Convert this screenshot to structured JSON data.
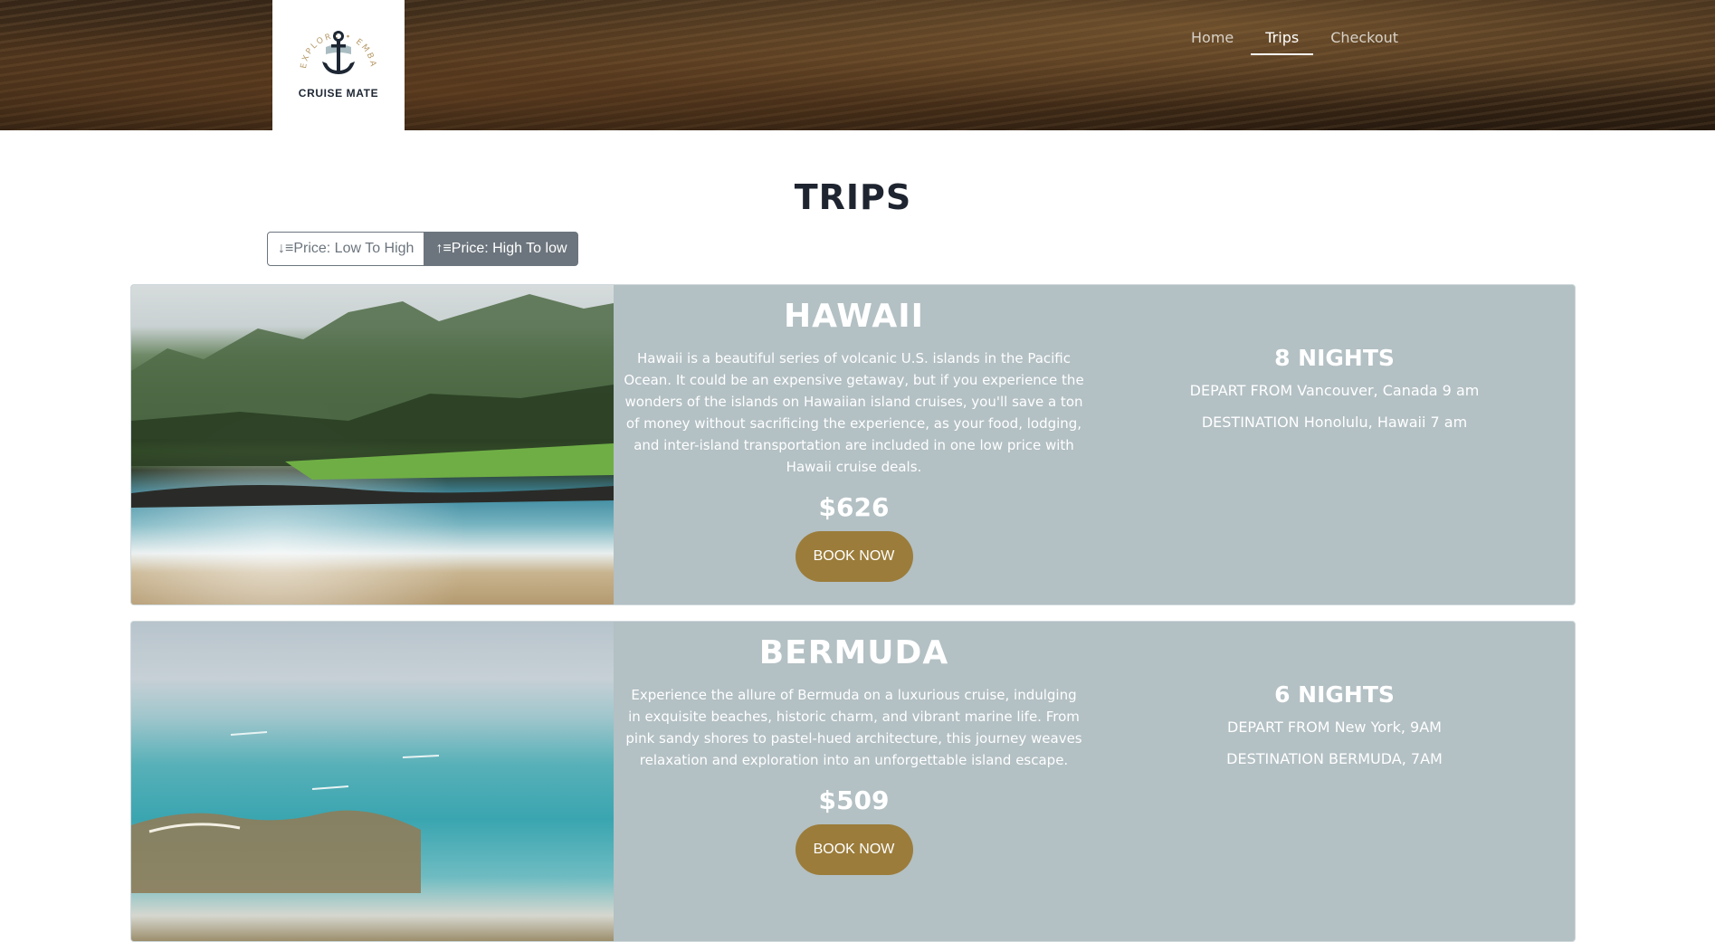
{
  "brand": {
    "name": "CRUISE MATE",
    "tagline": "EXPLORE • EMBARK • ENJOY!"
  },
  "nav": {
    "items": [
      {
        "label": "Home"
      },
      {
        "label": "Trips",
        "active": true
      },
      {
        "label": "Checkout"
      }
    ]
  },
  "page": {
    "title": "TRIPS"
  },
  "sort": {
    "low_to_high": "↓≡Price: Low To High",
    "high_to_low": "↑≡Price: High To low",
    "active": "high_to_low"
  },
  "trips": [
    {
      "destination": "HAWAII",
      "description": "Hawaii is a beautiful series of volcanic U.S. islands in the Pacific Ocean. It could be an expensive getaway, but if you experience the wonders of the islands on Hawaiian island cruises, you'll save a ton of money without sacrificing the experience, as your food, lodging, and inter-island transportation are included in one low price with Hawaii cruise deals.",
      "price": "$626",
      "button": "BOOK NOW",
      "nights": "8 NIGHTS",
      "depart": "DEPART FROM Vancouver, Canada 9 am",
      "arrive": "DESTINATION Honolulu, Hawaii 7 am"
    },
    {
      "destination": "BERMUDA",
      "description": "Experience the allure of Bermuda on a luxurious cruise, indulging in exquisite beaches, historic charm, and vibrant marine life. From pink sandy shores to pastel-hued architecture, this journey weaves relaxation and exploration into an unforgettable island escape.",
      "price": "$509",
      "button": "BOOK NOW",
      "nights": "6 NIGHTS",
      "depart": "DEPART FROM New York, 9AM",
      "arrive": "DESTINATION BERMUDA, 7AM"
    }
  ],
  "colors": {
    "card_bg": "#b3c0c4",
    "button_bg": "#9b7c3a",
    "sort_active": "#6c757d"
  }
}
